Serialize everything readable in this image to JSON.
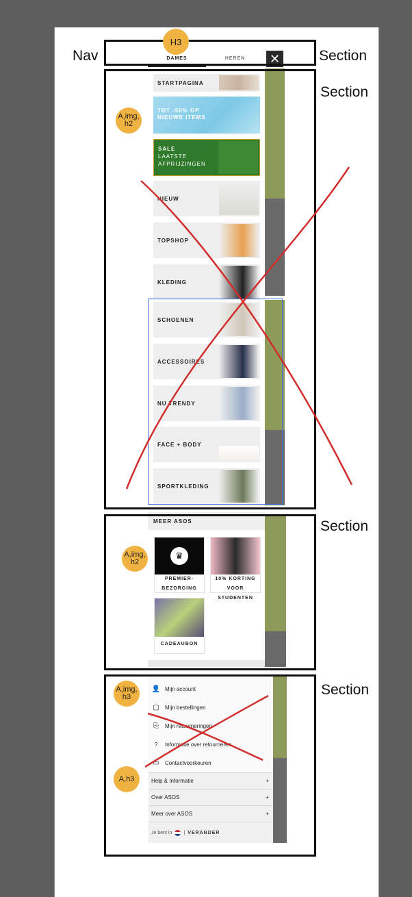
{
  "annotations": {
    "nav": "Nav",
    "section1": "Section",
    "section2": "Section",
    "section3": "Section",
    "section4": "Section",
    "badge_h3": "H3",
    "badge_a_img_h2_1": "A,img, h2",
    "badge_a_img_h2_2": "A,img, h2",
    "badge_a_img_h3": "A,img, h3",
    "badge_a_h3": "A,h3"
  },
  "tabs": {
    "women": "DAMES",
    "men": "HEREN",
    "close": "✕"
  },
  "categories": [
    {
      "label": "STARTPAGINA"
    },
    {
      "label": "TOT -50% OP NIEUWE ITEMS"
    },
    {
      "label": "SALE LAATSTE AFPRIJZINGEN"
    },
    {
      "label": "NIEUW"
    },
    {
      "label": "TOPSHOP"
    },
    {
      "label": "KLEDING"
    },
    {
      "label": "SCHOENEN"
    },
    {
      "label": "ACCESSOIRES"
    },
    {
      "label": "NU TRENDY"
    },
    {
      "label": "FACE + BODY"
    },
    {
      "label": "SPORTKLEDING"
    }
  ],
  "promo": {
    "line1": "TOT -50% OP",
    "line2": "NIEUWE ITEMS"
  },
  "sale": {
    "line1": "SALE",
    "line2": "LAATSTE",
    "line3": "AFPRIJZINGEN"
  },
  "more": {
    "title": "MEER ASOS",
    "premier_line1": "PREMIER-",
    "premier_line2": "BEZORGING",
    "students_line1": "10% KORTING",
    "students_line2": "VOOR STUDENTEN",
    "gift": "CADEAUBON"
  },
  "account": {
    "items": [
      {
        "label": "Mijn account",
        "icon": "user-icon"
      },
      {
        "label": "Mijn bestellingen",
        "icon": "package-icon"
      },
      {
        "label": "Mijn retourneringen",
        "icon": "return-icon"
      },
      {
        "label": "Informatie over retourneren",
        "icon": "question-icon"
      },
      {
        "label": "Contactvoorkeuren",
        "icon": "chat-icon"
      }
    ],
    "accordion": [
      {
        "label": "Help & Informatie",
        "toggle": "+"
      },
      {
        "label": "Over ASOS",
        "toggle": "+"
      },
      {
        "label": "Meer over ASOS",
        "toggle": "+"
      }
    ],
    "country_prefix": "Je bent in",
    "country_separator": "|",
    "change": "VERANDER"
  },
  "colors": {
    "annotation_badge": "#f0b240",
    "cross_line": "#d22c2c",
    "highlight_box": "#4a74d8",
    "sale_bg": "#2f7a2a",
    "promo_bg": "#8fd0ea",
    "side_strip": "#8e9a5a"
  }
}
